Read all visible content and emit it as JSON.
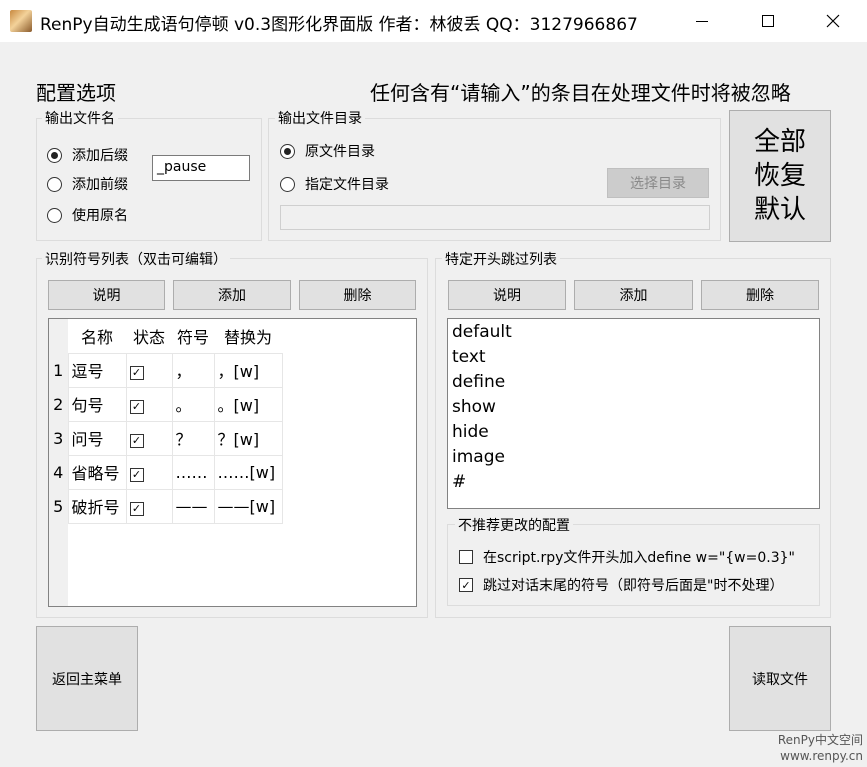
{
  "window": {
    "title": "RenPy自动生成语句停顿 v0.3图形化界面版  作者：林彼丢  QQ：3127966867"
  },
  "header": {
    "section_title": "配置选项",
    "hint": "任何含有“请输入”的条目在处理文件时将被忽略"
  },
  "output_filename": {
    "label": "输出文件名",
    "options": [
      {
        "label": "添加后缀",
        "selected": true
      },
      {
        "label": "添加前缀",
        "selected": false
      },
      {
        "label": "使用原名",
        "selected": false
      }
    ],
    "suffix_value": "_pause"
  },
  "output_dir": {
    "label": "输出文件目录",
    "options": [
      {
        "label": "原文件目录",
        "selected": true
      },
      {
        "label": "指定文件目录",
        "selected": false
      }
    ],
    "choose_button": "选择目录",
    "path_value": ""
  },
  "reset_button": {
    "line1": "全部",
    "line2": "恢复",
    "line3": "默认"
  },
  "symbol_list": {
    "label": "识别符号列表（双击可编辑）",
    "buttons": {
      "help": "说明",
      "add": "添加",
      "delete": "删除"
    },
    "columns": [
      "名称",
      "状态",
      "符号",
      "替换为"
    ],
    "rows": [
      {
        "index": "1",
        "name": "逗号",
        "checked": true,
        "symbol": "，",
        "replace": "，[w]"
      },
      {
        "index": "2",
        "name": "句号",
        "checked": true,
        "symbol": "。",
        "replace": "。[w]"
      },
      {
        "index": "3",
        "name": "问号",
        "checked": true,
        "symbol": "？",
        "replace": "？[w]"
      },
      {
        "index": "4",
        "name": "省略号",
        "checked": true,
        "symbol": "……",
        "replace": "……[w]"
      },
      {
        "index": "5",
        "name": "破折号",
        "checked": true,
        "symbol": "——",
        "replace": "——[w]"
      }
    ]
  },
  "skip_list": {
    "label": "特定开头跳过列表",
    "buttons": {
      "help": "说明",
      "add": "添加",
      "delete": "删除"
    },
    "items": [
      "default",
      "text",
      "define",
      "show",
      "hide",
      "image",
      "#"
    ]
  },
  "advanced": {
    "label": "不推荐更改的配置",
    "options": [
      {
        "label": "在script.rpy文件开头加入define w=\"{w=0.3}\"",
        "checked": false
      },
      {
        "label": "跳过对话末尾的符号（即符号后面是\"时不处理）",
        "checked": true
      }
    ]
  },
  "footer": {
    "back_button": "返回主菜单",
    "read_button": "读取文件"
  },
  "watermark": {
    "line1": "RenPy中文空间",
    "line2": "www.renpy.cn"
  },
  "glyphs": {
    "check": "✓"
  }
}
